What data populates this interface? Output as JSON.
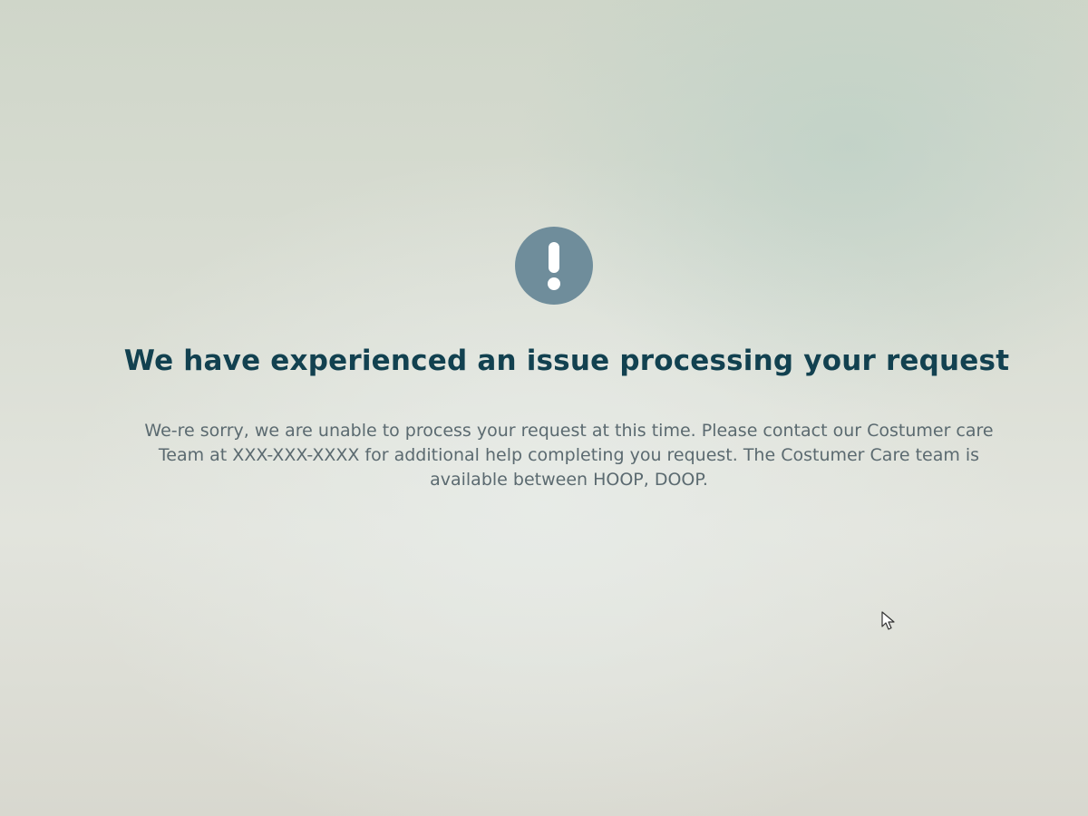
{
  "error_page": {
    "icon": "exclamation-circle-icon",
    "title": "We have experienced an issue processing your request",
    "message": "We-re sorry, we are unable to process your request at this time. Please contact our Costumer care Team at XXX-XXX-XXXX for additional help completing you request. The Costumer Care team is available between HOOP, DOOP."
  },
  "colors": {
    "icon_circle": "#6f8d9b",
    "title": "#124150",
    "message": "#5b6a70"
  }
}
